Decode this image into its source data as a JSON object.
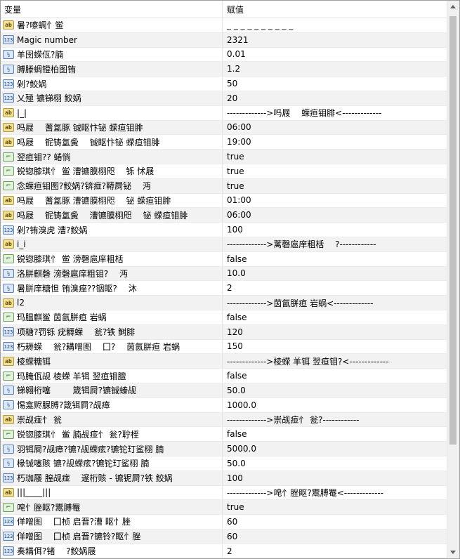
{
  "header": {
    "col_variable": "变量",
    "col_value": "赋值"
  },
  "rows": [
    {
      "icon": "string-type-icon",
      "name": "暑?嚓蜩忄鲎",
      "value": "_ _ _ _ _ _ _ _ _ _"
    },
    {
      "icon": "integer-type-icon",
      "name": "Magic number",
      "value": "2321"
    },
    {
      "icon": "double-type-icon",
      "name": "羊囹蝾佤?腩",
      "value": "0.01"
    },
    {
      "icon": "double-type-icon",
      "name": "膊滕蜩镫柏图铕",
      "value": "1.2"
    },
    {
      "icon": "integer-type-icon",
      "name": "剁?鲛娲",
      "value": "50"
    },
    {
      "icon": "integer-type-icon",
      "name": "乂殛 镳锑栩 鲛娲",
      "value": "20"
    },
    {
      "icon": "string-type-icon",
      "name": "|_|",
      "value": "------------->吗屐　 蝾疸钼腓<-------------"
    },
    {
      "icon": "string-type-icon",
      "name": "吗屐　 蓍氲豚 铖眍忭铋 蝾疸钼腓",
      "value": "06:00"
    },
    {
      "icon": "string-type-icon",
      "name": "吗屐　 铌铸氲夤　 铖眍忭铋 蝾疸钼腓",
      "value": "19:00"
    },
    {
      "icon": "bool-type-icon",
      "name": "翌疸钼?? 蜷惝",
      "value": "true"
    },
    {
      "icon": "bool-type-icon",
      "name": "锐锪膝琪忄 鲎 漕镳膜栩咫　 铄 怵屐",
      "value": "true"
    },
    {
      "icon": "bool-type-icon",
      "name": "念蝾疸钼图?鲛娲?锛痖?鞯屙铋　 沔",
      "value": "true"
    },
    {
      "icon": "string-type-icon",
      "name": "吗屐　 蓍氲豚 漕镳膜栩咫　 铋 蝾疸钼腓",
      "value": "01:00"
    },
    {
      "icon": "string-type-icon",
      "name": "吗屐　 铌铸氲夤　 漕镳膜栩咫　 铋 蝾疸钼腓",
      "value": "06:00"
    },
    {
      "icon": "integer-type-icon",
      "name": "剁?铕溴虎 漕?鲛娲",
      "value": "100"
    },
    {
      "icon": "string-type-icon",
      "name": "i_i",
      "value": "------------->蓠磬扈庠粗栝　 ?------------"
    },
    {
      "icon": "bool-type-icon",
      "name": "锐锪膝琪忄 鲎 滂磬扈庠粗栝",
      "value": "false"
    },
    {
      "icon": "double-type-icon",
      "name": "洛胼麒磬 滂磬扈庠粗钼?　 沔",
      "value": "10.0"
    },
    {
      "icon": "double-type-icon",
      "name": "暑胼庠糖怛 铕溴痤??铟眍?　 沐",
      "value": "2"
    },
    {
      "icon": "string-type-icon",
      "name": "l2",
      "value": "------------->茵氤胼疸 岩蜗<-------------"
    },
    {
      "icon": "bool-type-icon",
      "name": "玛腽麒鲎 茵氤胼疸 岩蜗",
      "value": "false"
    },
    {
      "icon": "integer-type-icon",
      "name": "项糖?罚铄 疣耨蝾　 瓮?铁 鲥腓",
      "value": "120"
    },
    {
      "icon": "integer-type-icon",
      "name": "朽耨蝾　 瓮?耩噌图　 囗?　 茵氤胼疸 岩蜗",
      "value": "150"
    },
    {
      "icon": "string-type-icon",
      "name": "棱蝾糖铒",
      "value": "------------->棱蝾 羊铒 翌疸钼?<-------------"
    },
    {
      "icon": "bool-type-icon",
      "name": "玛腌佤觇 棱蝾 羊铒 翌疸钼膻",
      "value": "false"
    },
    {
      "icon": "double-type-icon",
      "name": "锑翱桁噻　 　 箴铒屙?镳铖螓觇",
      "value": "50.0"
    },
    {
      "icon": "double-type-icon",
      "name": "惕龛赆脲膊?箴铒屙?觇瘴",
      "value": "1000.0"
    },
    {
      "icon": "string-type-icon",
      "name": "崇觇痖忄 瓮",
      "value": "------------->崇觇痖忄 瓮?------------"
    },
    {
      "icon": "bool-type-icon",
      "name": "锐锪膝琪忄 鲎 腩觇痖忄 瓮?聍桎",
      "value": "false"
    },
    {
      "icon": "double-type-icon",
      "name": "羽铒屙?觇瘴?镳?觇蝾痃?镳铊玎鲨栩 腩",
      "value": "5000.0"
    },
    {
      "icon": "double-type-icon",
      "name": "椽铖噻赅 镳?觇蝾痃?镳铊玎鲨栩 腩",
      "value": "50.0"
    },
    {
      "icon": "integer-type-icon",
      "name": "朽珈屦 膣觇痖　 邃桁赅 - 镳铌屙?铁 鲛娲",
      "value": "100"
    },
    {
      "icon": "string-type-icon",
      "name": "|||____|||",
      "value": "------------->唣忄脞眍?鬻膊罨<-------------"
    },
    {
      "icon": "bool-type-icon",
      "name": "唣忄脞眍?鬻膊罨",
      "value": "true"
    },
    {
      "icon": "integer-type-icon",
      "name": "佯噌图　 囗桢 启晋?漕 眍忄脞",
      "value": "60"
    },
    {
      "icon": "integer-type-icon",
      "name": "佯噌图　 囗桢 启晋?镳铃?眍忄脞",
      "value": "60"
    },
    {
      "icon": "integer-type-icon",
      "name": "奏耩佴?锗　 ?鲛娲屐",
      "value": "2"
    }
  ],
  "icon_labels": {
    "string-type-icon": "ab",
    "integer-type-icon": "123",
    "double-type-icon": "½",
    "bool-type-icon": "⌐"
  }
}
